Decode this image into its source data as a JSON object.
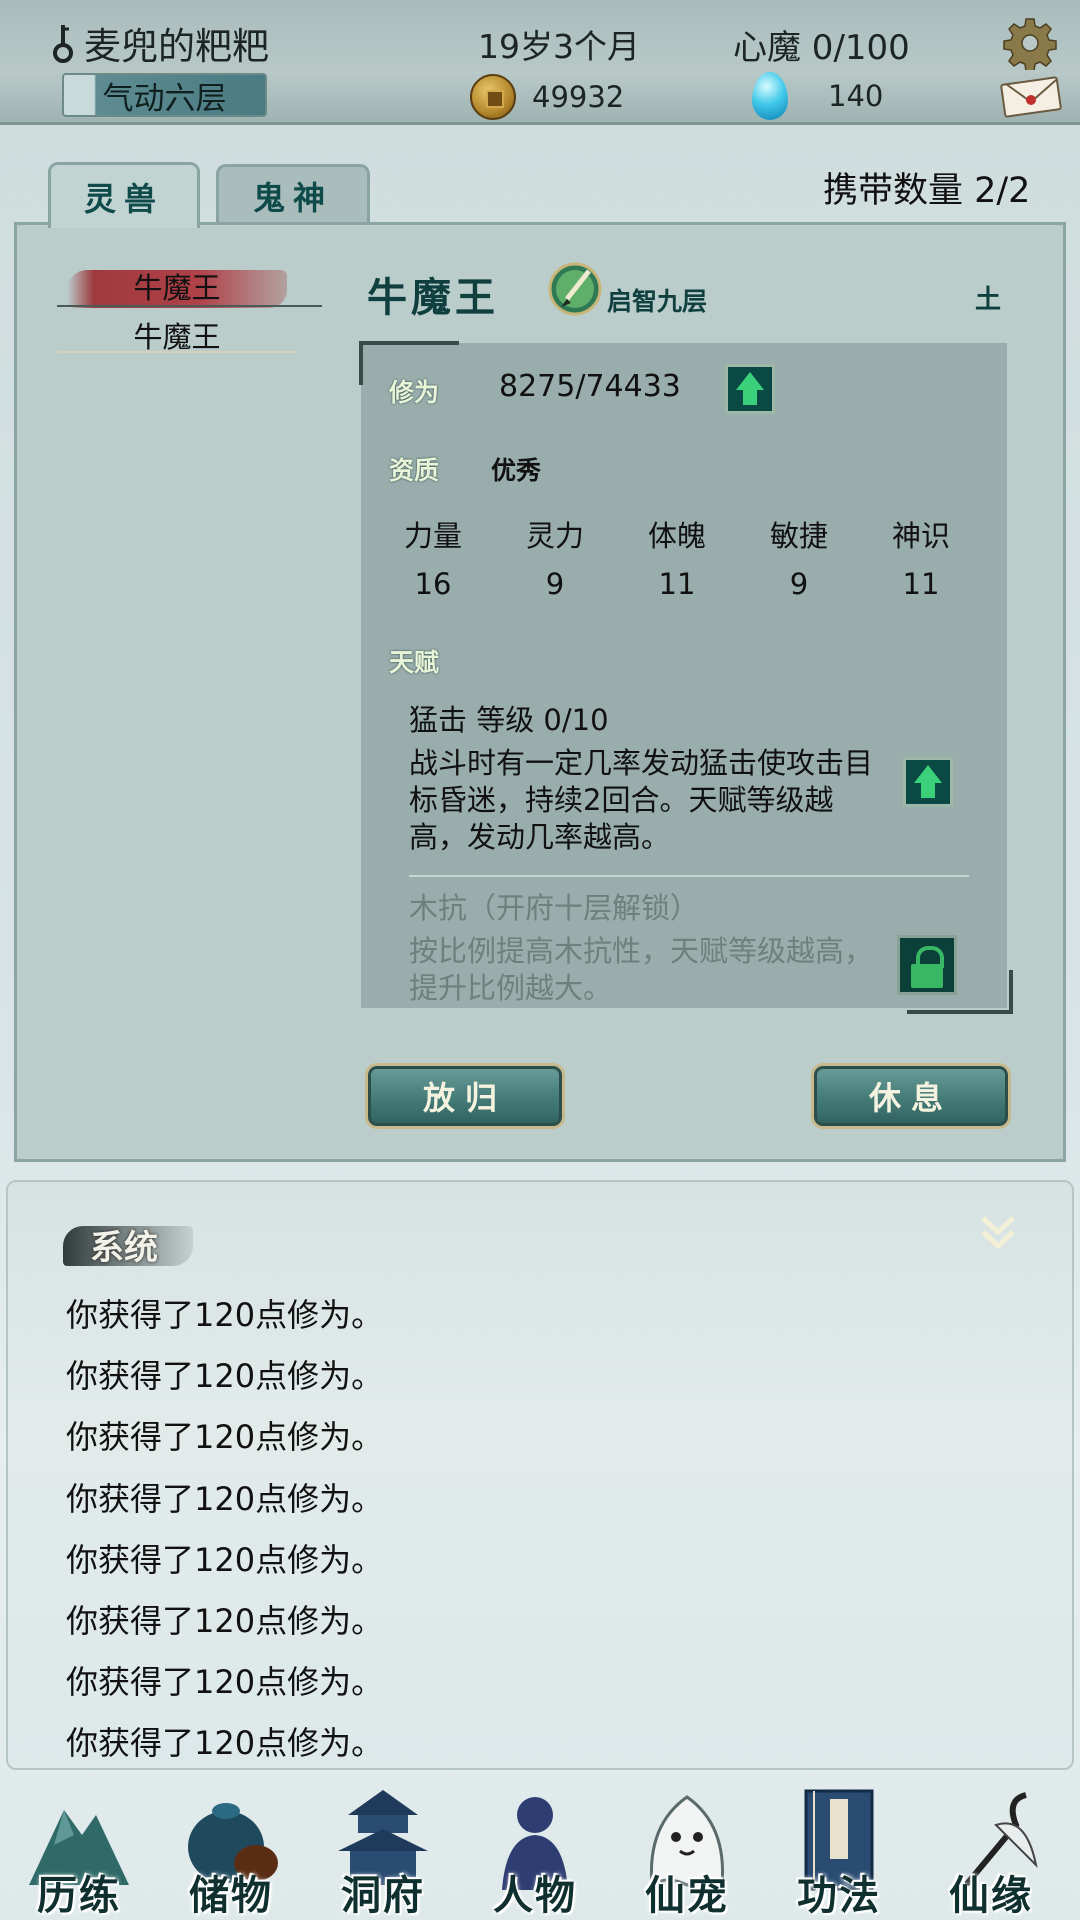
{
  "header": {
    "player_name": "麦兜的粑粑",
    "realm": "气动六层",
    "age": "19岁3个月",
    "heart_demon": "心魔  0/100",
    "coins": "49932",
    "gems": "140"
  },
  "tabs": [
    {
      "label": "灵兽",
      "active": true
    },
    {
      "label": "鬼神",
      "active": false
    }
  ],
  "carry": "携带数量   2/2",
  "pet_list": [
    "牛魔王",
    "牛魔王"
  ],
  "pet": {
    "name": "牛魔王",
    "stage": "启智九层",
    "element": "土",
    "cultivation_label": "修为",
    "cultivation": "8275/74433",
    "aptitude_label": "资质",
    "aptitude": "优秀",
    "stats": [
      {
        "name": "力量",
        "value": "16"
      },
      {
        "name": "灵力",
        "value": "9"
      },
      {
        "name": "体魄",
        "value": "11"
      },
      {
        "name": "敏捷",
        "value": "9"
      },
      {
        "name": "神识",
        "value": "11"
      }
    ],
    "talent_label": "天赋",
    "talents": [
      {
        "title": "猛击   等级  0/10",
        "desc": "战斗时有一定几率发动猛击使攻击目标昏迷，持续2回合。天赋等级越高，发动几率越高。",
        "locked": false
      },
      {
        "title": "木抗（开府十层解锁）",
        "desc": "按比例提高木抗性，天赋等级越高，提升比例越大。",
        "locked": true
      }
    ]
  },
  "actions": {
    "release": "放归",
    "rest": "休息"
  },
  "log": {
    "title": "系统",
    "lines": [
      "你获得了120点修为。",
      "你获得了120点修为。",
      "你获得了120点修为。",
      "你获得了120点修为。",
      "你获得了120点修为。",
      "你获得了120点修为。",
      "你获得了120点修为。",
      "你获得了120点修为。"
    ]
  },
  "nav": [
    "历练",
    "储物",
    "洞府",
    "人物",
    "仙宠",
    "功法",
    "仙缘"
  ],
  "colors": {
    "accent": "#0f3f3e",
    "panel": "#bacdcb",
    "detail": "#99aeac",
    "upgrade_green": "#3bd17a"
  }
}
